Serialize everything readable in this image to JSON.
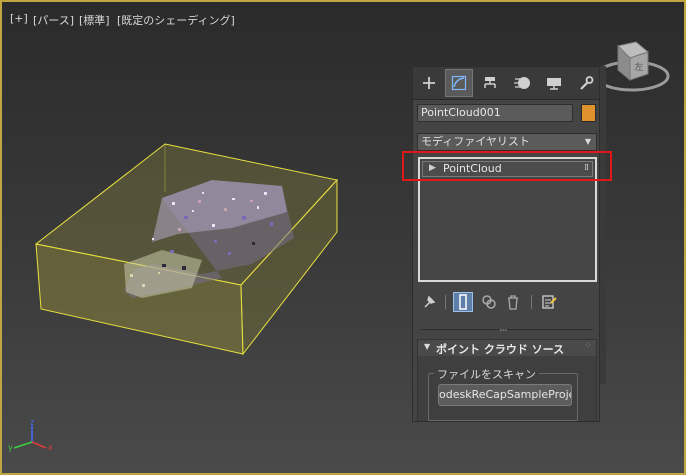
{
  "viewport": {
    "labels": [
      "[+]",
      "[パース]",
      "[標準]",
      "[既定のシェーディング]"
    ],
    "viewcube_face_label": "左",
    "axis_labels": {
      "x": "x",
      "y": "y",
      "z": "z"
    }
  },
  "command_panel": {
    "tabs": [
      {
        "name": "create",
        "icon": "plus-icon"
      },
      {
        "name": "modify",
        "icon": "modify-arc-icon",
        "active": true
      },
      {
        "name": "hierarchy",
        "icon": "hierarchy-icon"
      },
      {
        "name": "motion",
        "icon": "motion-icon"
      },
      {
        "name": "display",
        "icon": "display-monitor-icon"
      },
      {
        "name": "utilities",
        "icon": "wrench-icon"
      }
    ],
    "object_name": "PointCloud001",
    "object_color": "#e0922c",
    "modifier_list_label": "モディファイヤリスト",
    "stack_items": [
      "PointCloud"
    ],
    "stack_toolbar": [
      "pin-icon",
      "show-end-result-icon",
      "make-unique-icon",
      "remove-modifier-icon",
      "configure-sets-icon"
    ],
    "rollout": {
      "title": "ポイント クラウド ソース",
      "group_label": "ファイルをスキャン",
      "scan_file_button": "odeskReCapSampleProject."
    }
  },
  "colors": {
    "highlight_frame": "#e01818",
    "bounding_box": "#e8e040",
    "viewport_border": "#bfa640"
  }
}
